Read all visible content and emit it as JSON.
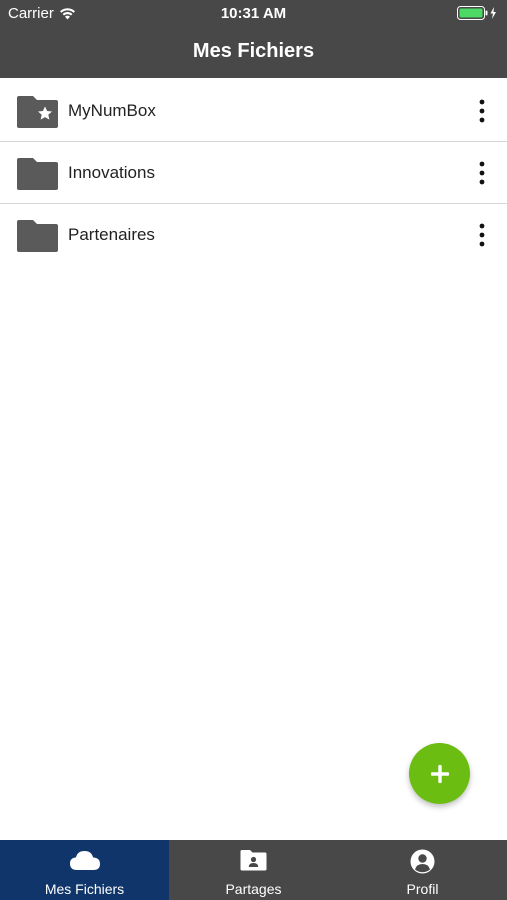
{
  "status_bar": {
    "carrier": "Carrier",
    "time": "10:31 AM",
    "wifi_icon": "wifi-icon",
    "battery_icon": "battery-charging-icon",
    "battery_level": 1.0
  },
  "nav": {
    "title": "Mes Fichiers"
  },
  "folders": [
    {
      "name": "MyNumBox",
      "icon": "starred-folder-icon"
    },
    {
      "name": "Innovations",
      "icon": "folder-icon"
    },
    {
      "name": "Partenaires",
      "icon": "folder-icon"
    }
  ],
  "fab": {
    "icon": "plus-icon",
    "color": "#6cbd12"
  },
  "tabs": [
    {
      "label": "Mes Fichiers",
      "icon": "cloud-icon",
      "active": true
    },
    {
      "label": "Partages",
      "icon": "shared-folder-icon",
      "active": false
    },
    {
      "label": "Profil",
      "icon": "user-circle-icon",
      "active": false
    }
  ],
  "colors": {
    "header": "#484848",
    "tab_active": "#0f356b",
    "folder": "#5a5a5a",
    "accent": "#6cbd12"
  }
}
